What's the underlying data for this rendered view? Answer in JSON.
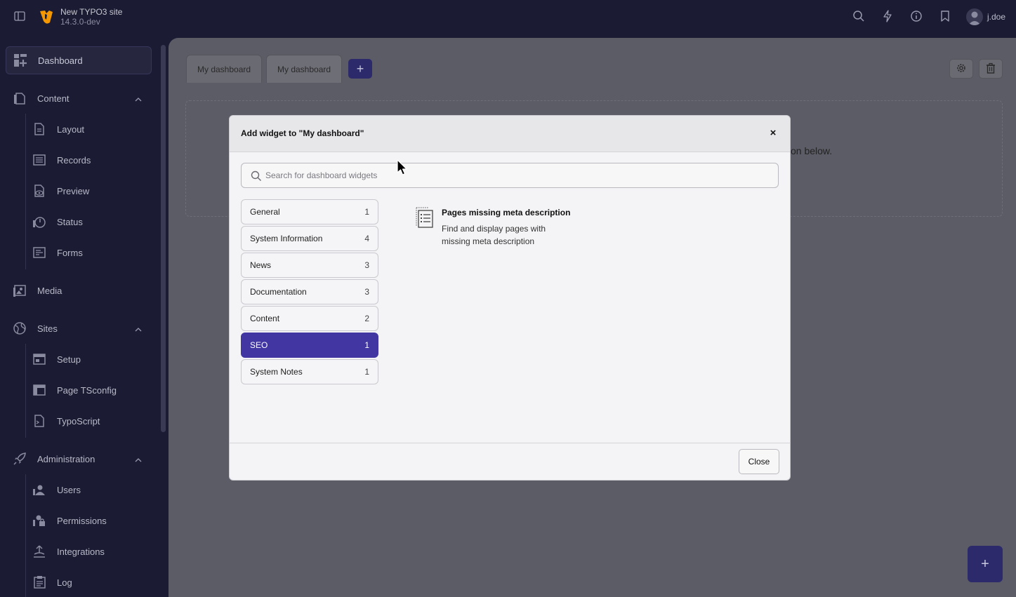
{
  "topbar": {
    "site_name": "New TYPO3 site",
    "site_version": "14.3.0-dev",
    "username": "j.doe",
    "icons": [
      "sidebar-toggle-icon",
      "typo3-logo",
      "search-icon",
      "flash-icon",
      "info-icon",
      "bookmark-icon",
      "user-avatar-icon"
    ]
  },
  "sidebar": {
    "items": [
      {
        "label": "Dashboard",
        "icon": "dashboard-icon",
        "active": true
      },
      {
        "label": "Content",
        "icon": "content-icon",
        "expandable": true
      },
      {
        "label": "Layout",
        "icon": "layout-icon",
        "sub": true
      },
      {
        "label": "Records",
        "icon": "records-icon",
        "sub": true
      },
      {
        "label": "Preview",
        "icon": "preview-icon",
        "sub": true
      },
      {
        "label": "Status",
        "icon": "status-icon",
        "sub": true
      },
      {
        "label": "Forms",
        "icon": "forms-icon",
        "sub": true
      },
      {
        "label": "Media",
        "icon": "media-icon"
      },
      {
        "label": "Sites",
        "icon": "sites-icon",
        "expandable": true
      },
      {
        "label": "Setup",
        "icon": "setup-icon",
        "sub": true
      },
      {
        "label": "Page TSconfig",
        "icon": "page-tsconfig-icon",
        "sub": true
      },
      {
        "label": "TypoScript",
        "icon": "typoscript-icon",
        "sub": true
      },
      {
        "label": "Administration",
        "icon": "administration-icon",
        "expandable": true
      },
      {
        "label": "Users",
        "icon": "users-icon",
        "sub": true
      },
      {
        "label": "Permissions",
        "icon": "permissions-icon",
        "sub": true
      },
      {
        "label": "Integrations",
        "icon": "integrations-icon",
        "sub": true
      },
      {
        "label": "Log",
        "icon": "log-icon",
        "sub": true
      }
    ]
  },
  "main": {
    "tabs": [
      {
        "label": "My dashboard"
      },
      {
        "label": "My dashboard",
        "active": true
      }
    ],
    "add_tab_label": "+",
    "background_hint": "on below.",
    "fab_label": "+"
  },
  "modal": {
    "title": "Add widget to \"My dashboard\"",
    "close_symbol": "×",
    "search_placeholder": "Search for dashboard widgets",
    "search_value": "",
    "categories": [
      {
        "label": "General",
        "count": "1"
      },
      {
        "label": "System Information",
        "count": "4"
      },
      {
        "label": "News",
        "count": "3"
      },
      {
        "label": "Documentation",
        "count": "3"
      },
      {
        "label": "Content",
        "count": "2"
      },
      {
        "label": "SEO",
        "count": "1",
        "active": true
      },
      {
        "label": "System Notes",
        "count": "1"
      }
    ],
    "widget": {
      "title": "Pages missing meta description",
      "description": "Find and display pages with missing meta description",
      "icon": "list-document-icon"
    },
    "footer_close_label": "Close"
  },
  "colors": {
    "chrome_bg": "#1b1b33",
    "accent": "#4136a2",
    "overlay_main": "#5c5c66",
    "modal_bg": "#f4f4f6"
  }
}
